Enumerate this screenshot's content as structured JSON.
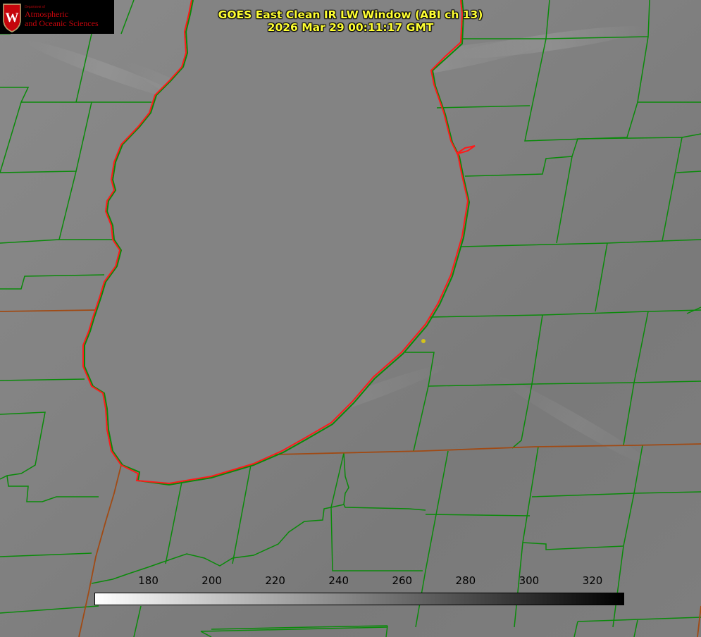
{
  "title": {
    "line1": "GOES East Clean IR LW Window (ABI ch 13)",
    "line2": "2026 Mar 29 00:11:17 GMT",
    "color": "#ffff33"
  },
  "logo": {
    "dept": "Department of",
    "line1": "Atmospheric",
    "line2": "and Oceanic Sciences",
    "crest_letter": "W",
    "color": "#c5050c"
  },
  "colorbar": {
    "min": 163,
    "max": 330,
    "ticks": [
      180,
      200,
      220,
      240,
      260,
      280,
      300,
      320
    ],
    "tick_labels": [
      "180",
      "200",
      "220",
      "240",
      "260",
      "280",
      "300",
      "320"
    ],
    "colors": [
      "#ffffff",
      "#000000"
    ]
  },
  "map": {
    "lake_name": "Lake Michigan",
    "lake_outline_color": "#ff1a1a",
    "county_line_color": "#0a8a0a",
    "state_line_color": "#a04a14",
    "marker_color": "#d4c21a",
    "background": "#7f7f7f"
  }
}
